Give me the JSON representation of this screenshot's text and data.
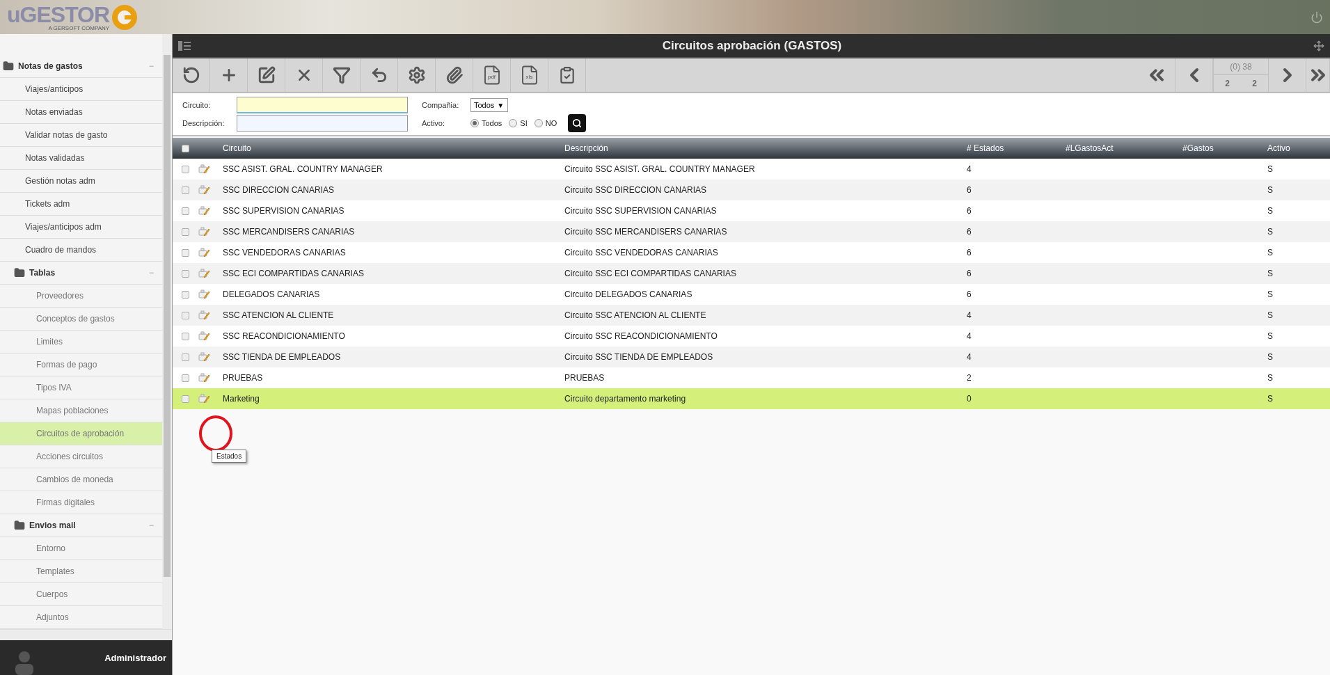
{
  "logo": {
    "name": "uGESTOR",
    "tagline": "A GERSOFT COMPANY"
  },
  "sidebar": {
    "items": [
      {
        "label": "Notas de gastos",
        "toggle": "−",
        "expanded": true,
        "selected": false,
        "children": [
          {
            "label": "Viajes/anticipos",
            "selected": false
          },
          {
            "label": "Notas enviadas",
            "selected": false
          },
          {
            "label": "Validar notas de gasto",
            "selected": false
          },
          {
            "label": "Notas validadas",
            "selected": false
          },
          {
            "label": "Gestión notas adm",
            "selected": false
          },
          {
            "label": "Tickets adm",
            "selected": false
          },
          {
            "label": "Viajes/anticipos adm",
            "selected": false
          },
          {
            "label": "Cuadro de mandos",
            "selected": false
          },
          {
            "label": "Tablas",
            "toggle": "−",
            "expanded": true,
            "selected": false,
            "children": [
              {
                "label": "Proveedores",
                "selected": false
              },
              {
                "label": "Conceptos de gastos",
                "selected": false
              },
              {
                "label": "Limites",
                "selected": false
              },
              {
                "label": "Formas de pago",
                "selected": false
              },
              {
                "label": "Tipos IVA",
                "selected": false
              },
              {
                "label": "Mapas poblaciones",
                "selected": false
              },
              {
                "label": "Circuitos de aprobación",
                "selected": true
              },
              {
                "label": "Acciones circuitos",
                "selected": false
              },
              {
                "label": "Cambios de moneda",
                "selected": false
              },
              {
                "label": "Firmas digitales",
                "selected": false
              }
            ]
          },
          {
            "label": "Envios mail",
            "toggle": "−",
            "expanded": true,
            "selected": false,
            "children": [
              {
                "label": "Entorno",
                "selected": false
              },
              {
                "label": "Templates",
                "selected": false
              },
              {
                "label": "Cuerpos",
                "selected": false
              },
              {
                "label": "Adjuntos",
                "selected": false
              }
            ]
          }
        ]
      }
    ]
  },
  "user": {
    "name": "Administrador"
  },
  "window": {
    "title": "Circuitos aprobación (GASTOS)"
  },
  "toolbar": {
    "file_labels": [
      "pdf",
      "xls"
    ]
  },
  "pager": {
    "selected_count": "(0)",
    "total": "38",
    "page": "2",
    "pages": "2"
  },
  "filters": {
    "circuito": {
      "label": "Circuito:"
    },
    "descripcion": {
      "label": "Descripción:"
    },
    "compania": {
      "label": "Compañia:",
      "value": "Todos",
      "caret": "▼"
    },
    "activo": {
      "label": "Activo:",
      "options": [
        {
          "label": "Todos",
          "selected": true
        },
        {
          "label": "SI",
          "selected": false
        },
        {
          "label": "NO",
          "selected": false
        }
      ]
    }
  },
  "table": {
    "header_checked": false,
    "columns": [
      "Circuito",
      "Descripción",
      "# Estados",
      "#LGastosAct",
      "#Gastos",
      "Activo"
    ],
    "rows": [
      {
        "checked": false,
        "selected": false,
        "cells": [
          "SSC ASIST. GRAL. COUNTRY MANAGER",
          "Circuito SSC ASIST. GRAL. COUNTRY MANAGER",
          "4",
          "",
          "",
          "S"
        ]
      },
      {
        "checked": false,
        "selected": false,
        "cells": [
          "SSC DIRECCION CANARIAS",
          "Circuito SSC DIRECCION CANARIAS",
          "6",
          "",
          "",
          "S"
        ]
      },
      {
        "checked": false,
        "selected": false,
        "cells": [
          "SSC SUPERVISION CANARIAS",
          "Circuito SSC SUPERVISION CANARIAS",
          "6",
          "",
          "",
          "S"
        ]
      },
      {
        "checked": false,
        "selected": false,
        "cells": [
          "SSC MERCANDISERS CANARIAS",
          "Circuito SSC MERCANDISERS CANARIAS",
          "6",
          "",
          "",
          "S"
        ]
      },
      {
        "checked": false,
        "selected": false,
        "cells": [
          "SSC VENDEDORAS CANARIAS",
          "Circuito SSC VENDEDORAS CANARIAS",
          "6",
          "",
          "",
          "S"
        ]
      },
      {
        "checked": false,
        "selected": false,
        "cells": [
          "SSC ECI COMPARTIDAS CANARIAS",
          "Circuito SSC ECI COMPARTIDAS CANARIAS",
          "6",
          "",
          "",
          "S"
        ]
      },
      {
        "checked": false,
        "selected": false,
        "cells": [
          "DELEGADOS CANARIAS",
          "Circuito DELEGADOS CANARIAS",
          "6",
          "",
          "",
          "S"
        ]
      },
      {
        "checked": false,
        "selected": false,
        "cells": [
          "SSC ATENCION AL CLIENTE",
          "Circuito SSC ATENCION AL CLIENTE",
          "4",
          "",
          "",
          "S"
        ]
      },
      {
        "checked": false,
        "selected": false,
        "cells": [
          "SSC REACONDICIONAMIENTO",
          "Circuito SSC REACONDICIONAMIENTO",
          "4",
          "",
          "",
          "S"
        ]
      },
      {
        "checked": false,
        "selected": false,
        "cells": [
          "SSC TIENDA DE EMPLEADOS",
          "Circuito SSC TIENDA DE EMPLEADOS",
          "4",
          "",
          "",
          "S"
        ]
      },
      {
        "checked": false,
        "selected": false,
        "cells": [
          "PRUEBAS",
          "PRUEBAS",
          "2",
          "",
          "",
          "S"
        ]
      },
      {
        "checked": false,
        "selected": true,
        "cells": [
          "Marketing",
          "Circuito departamento marketing",
          "0",
          "",
          "",
          "S"
        ]
      }
    ]
  },
  "tooltip": {
    "text": "Estados"
  }
}
